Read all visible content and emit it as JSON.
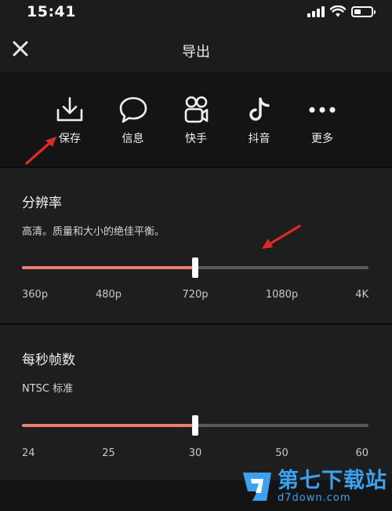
{
  "status": {
    "time": "15:41"
  },
  "header": {
    "title": "导出",
    "close_icon": "close-icon"
  },
  "share_targets": [
    {
      "label": "保存",
      "icon": "download-icon"
    },
    {
      "label": "信息",
      "icon": "chat-bubble-icon"
    },
    {
      "label": "快手",
      "icon": "kuaishou-icon"
    },
    {
      "label": "抖音",
      "icon": "douyin-icon"
    },
    {
      "label": "更多",
      "icon": "more-dots-icon"
    }
  ],
  "resolution": {
    "title": "分辨率",
    "description": "高清。质量和大小的绝佳平衡。",
    "ticks": [
      "360p",
      "480p",
      "720p",
      "1080p",
      "4K"
    ],
    "selected": "720p",
    "selected_index": 2
  },
  "frame_rate": {
    "title": "每秒帧数",
    "description": "NTSC 标准",
    "ticks": [
      "24",
      "25",
      "30",
      "50",
      "60"
    ],
    "selected": "30",
    "selected_index": 2
  },
  "colors": {
    "accent": "#e8806c",
    "arrow": "#e02a2a",
    "watermark": "#3aa2f0"
  },
  "watermark": {
    "name": "第七下载站",
    "url": "d7down.com"
  }
}
